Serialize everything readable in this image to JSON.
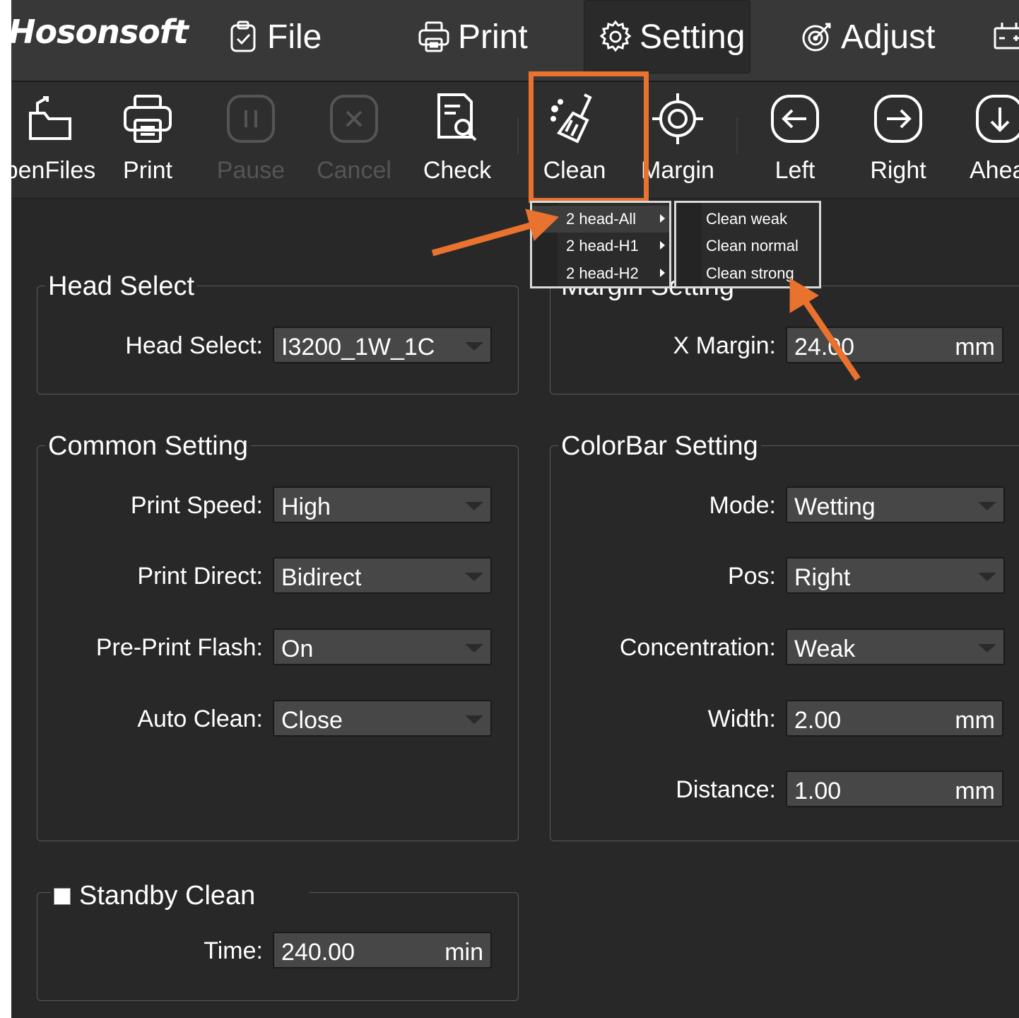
{
  "menubar": {
    "logo": "Hosonsoft",
    "items": [
      {
        "label": "File",
        "icon": "clipboard-check-icon"
      },
      {
        "label": "Print",
        "icon": "printer-icon"
      },
      {
        "label": "Setting",
        "icon": "gear-icon",
        "active": true
      },
      {
        "label": "Adjust",
        "icon": "adjust-target-icon"
      }
    ]
  },
  "toolbar": {
    "items": [
      {
        "label": "penFiles",
        "icon": "open-folder-icon",
        "enabled": true
      },
      {
        "label": "Print",
        "icon": "printer-icon",
        "enabled": true
      },
      {
        "label": "Pause",
        "icon": "pause-icon",
        "enabled": false
      },
      {
        "label": "Cancel",
        "icon": "cancel-icon",
        "enabled": false
      },
      {
        "label": "Check",
        "icon": "document-search-icon",
        "enabled": true
      },
      {
        "label": "Clean",
        "icon": "broom-icon",
        "enabled": true,
        "highlighted": true
      },
      {
        "label": "Margin",
        "icon": "crosshair-icon",
        "enabled": true
      },
      {
        "label": "Left",
        "icon": "arrow-left-circle-icon",
        "enabled": true
      },
      {
        "label": "Right",
        "icon": "arrow-right-circle-icon",
        "enabled": true
      },
      {
        "label": "Ahea",
        "icon": "arrow-down-circle-icon",
        "enabled": true
      }
    ]
  },
  "clean_menu": {
    "items": [
      {
        "label": "2 head-All",
        "selected": true
      },
      {
        "label": "2 head-H1",
        "selected": false
      },
      {
        "label": "2 head-H2",
        "selected": false
      }
    ],
    "submenu": [
      "Clean weak",
      "Clean normal",
      "Clean strong"
    ]
  },
  "head_select": {
    "title": "Head Select",
    "label": "Head Select:",
    "value": "I3200_1W_1C"
  },
  "margin_setting": {
    "title": "Margin Setting",
    "x_label": "X Margin:",
    "x_value": "24.00",
    "unit": "mm"
  },
  "common_setting": {
    "title": "Common Setting",
    "rows": [
      {
        "label": "Print Speed:",
        "value": "High"
      },
      {
        "label": "Print Direct:",
        "value": "Bidirect"
      },
      {
        "label": "Pre-Print Flash:",
        "value": "On"
      },
      {
        "label": "Auto Clean:",
        "value": "Close"
      }
    ]
  },
  "colorbar_setting": {
    "title": "ColorBar Setting",
    "combos": [
      {
        "label": "Mode:",
        "value": "Wetting"
      },
      {
        "label": "Pos:",
        "value": "Right"
      },
      {
        "label": "Concentration:",
        "value": "Weak"
      }
    ],
    "numbers": [
      {
        "label": "Width:",
        "value": "2.00",
        "unit": "mm"
      },
      {
        "label": "Distance:",
        "value": "1.00",
        "unit": "mm"
      }
    ]
  },
  "standby_clean": {
    "title": "Standby Clean",
    "checked": true,
    "time_label": "Time:",
    "time_value": "240.00",
    "unit": "min"
  },
  "colors": {
    "background": "#282828",
    "menubar": "#383838",
    "annotation": "#e8722e",
    "disabled_text": "#555555"
  }
}
